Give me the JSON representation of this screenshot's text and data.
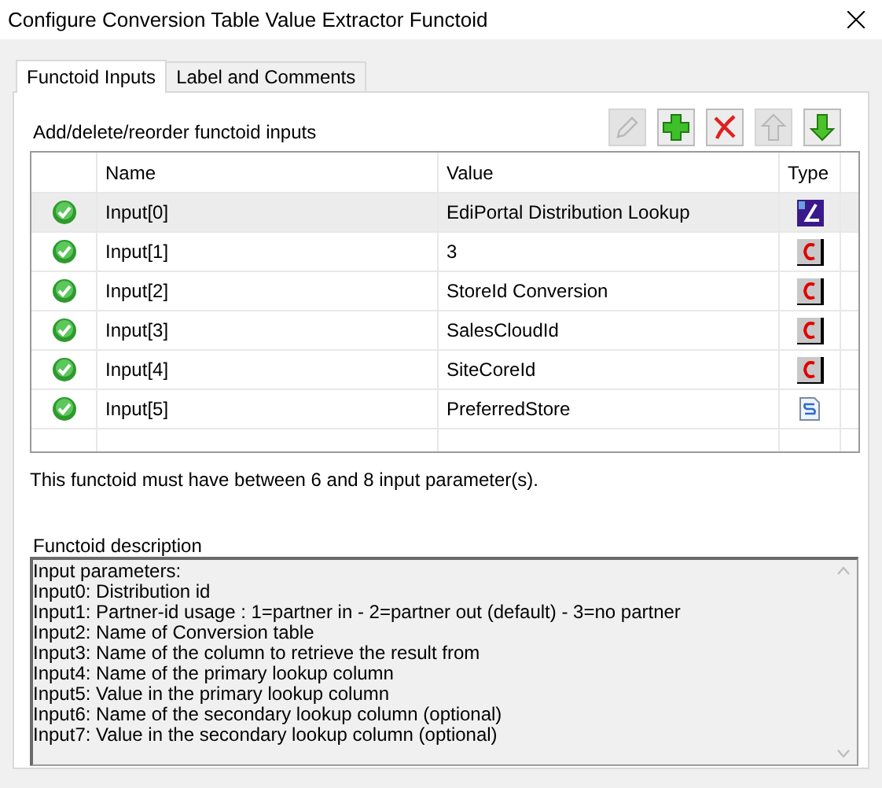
{
  "window": {
    "title": "Configure Conversion Table Value Extractor Functoid"
  },
  "tabs": [
    {
      "label": "Functoid Inputs",
      "selected": true
    },
    {
      "label": "Label and Comments",
      "selected": false
    }
  ],
  "inputs_label": "Add/delete/reorder functoid inputs",
  "toolbar": [
    {
      "kind": "edit",
      "disabled": true
    },
    {
      "kind": "add",
      "disabled": false
    },
    {
      "kind": "delete",
      "disabled": false
    },
    {
      "kind": "up",
      "disabled": true
    },
    {
      "kind": "down",
      "disabled": false
    }
  ],
  "table": {
    "columns": [
      "Name",
      "Value",
      "Type"
    ],
    "rows": [
      {
        "name": "Input[0]",
        "value": "EdiPortal Distribution Lookup",
        "kind": "parameter",
        "selected": true
      },
      {
        "name": "Input[1]",
        "value": "3",
        "kind": "constant",
        "selected": false
      },
      {
        "name": "Input[2]",
        "value": "StoreId Conversion",
        "kind": "constant",
        "selected": false
      },
      {
        "name": "Input[3]",
        "value": "SalesCloudId",
        "kind": "constant",
        "selected": false
      },
      {
        "name": "Input[4]",
        "value": "SiteCoreId",
        "kind": "constant",
        "selected": false
      },
      {
        "name": "Input[5]",
        "value": "PreferredStore",
        "kind": "link",
        "selected": false
      }
    ]
  },
  "message": "This functoid must have between 6 and 8 input parameter(s).",
  "description": {
    "label": "Functoid description",
    "lines": [
      "Input parameters:",
      "Input0: Distribution id",
      "Input1: Partner-id usage : 1=partner in - 2=partner out (default) - 3=no partner",
      "Input2: Name of Conversion table",
      "Input3: Name of the column to retrieve the result from",
      "Input4: Name of the primary lookup column",
      "Input5: Value in the primary lookup column",
      "Input6: Name of the secondary lookup column (optional)",
      "Input7: Value in the secondary lookup column (optional)"
    ]
  }
}
